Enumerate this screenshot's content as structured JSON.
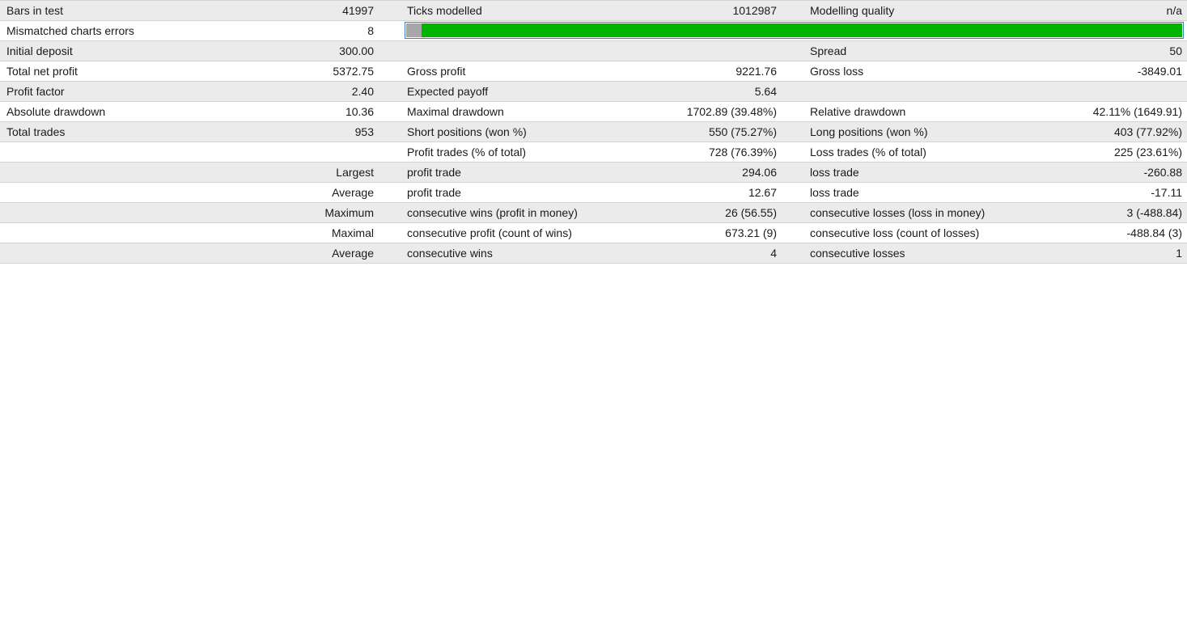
{
  "rows": [
    {
      "c1_label": "Bars in test",
      "c1_value": "41997",
      "c2_label": "Ticks modelled",
      "c2_value": "1012987",
      "c3_label": "Modelling quality",
      "c3_value": "n/a"
    },
    {
      "c1_label": "Mismatched charts errors",
      "c1_value": "8"
    },
    {
      "c1_label": "Initial deposit",
      "c1_value": "300.00",
      "c2_label": "",
      "c2_value": "",
      "c3_label": "Spread",
      "c3_value": "50"
    },
    {
      "c1_label": "Total net profit",
      "c1_value": "5372.75",
      "c2_label": "Gross profit",
      "c2_value": "9221.76",
      "c3_label": "Gross loss",
      "c3_value": "-3849.01"
    },
    {
      "c1_label": "Profit factor",
      "c1_value": "2.40",
      "c2_label": "Expected payoff",
      "c2_value": "5.64",
      "c3_label": "",
      "c3_value": ""
    },
    {
      "c1_label": "Absolute drawdown",
      "c1_value": "10.36",
      "c2_label": "Maximal drawdown",
      "c2_value": "1702.89 (39.48%)",
      "c3_label": "Relative drawdown",
      "c3_value": "42.11% (1649.91)"
    },
    {
      "c1_label": "Total trades",
      "c1_value": "953",
      "c2_label": "Short positions (won %)",
      "c2_value": "550 (75.27%)",
      "c3_label": "Long positions (won %)",
      "c3_value": "403 (77.92%)"
    },
    {
      "c1_label": "",
      "c1_value": "",
      "c2_label": "Profit trades (% of total)",
      "c2_value": "728 (76.39%)",
      "c3_label": "Loss trades (% of total)",
      "c3_value": "225 (23.61%)"
    },
    {
      "c1_label": "",
      "c1_value": "Largest",
      "c2_label": "profit trade",
      "c2_value": "294.06",
      "c3_label": "loss trade",
      "c3_value": "-260.88"
    },
    {
      "c1_label": "",
      "c1_value": "Average",
      "c2_label": "profit trade",
      "c2_value": "12.67",
      "c3_label": "loss trade",
      "c3_value": "-17.11"
    },
    {
      "c1_label": "",
      "c1_value": "Maximum",
      "c2_label": "consecutive wins (profit in money)",
      "c2_value": "26 (56.55)",
      "c3_label": "consecutive losses (loss in money)",
      "c3_value": "3 (-488.84)"
    },
    {
      "c1_label": "",
      "c1_value": "Maximal",
      "c2_label": "consecutive profit (count of wins)",
      "c2_value": "673.21 (9)",
      "c3_label": "consecutive loss (count of losses)",
      "c3_value": "-488.84 (3)"
    },
    {
      "c1_label": "",
      "c1_value": "Average",
      "c2_label": "consecutive wins",
      "c2_value": "4",
      "c3_label": "consecutive losses",
      "c3_value": "1"
    }
  ],
  "quality_bar": {
    "level_fraction": 0.98,
    "gray_color": "#a7a7a7",
    "fill_color": "#00b400",
    "border_color": "#3c7fc0"
  }
}
